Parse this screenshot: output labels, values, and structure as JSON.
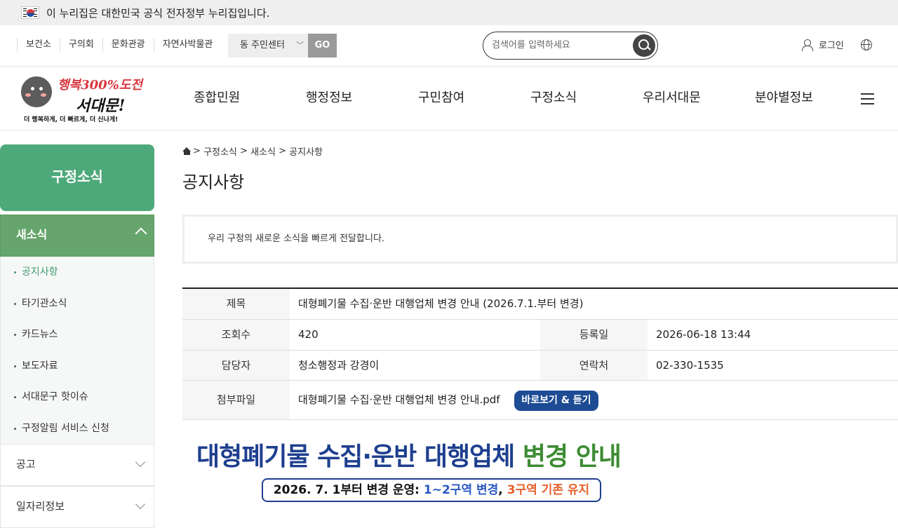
{
  "govbar": {
    "text": "이 누리집은 대한민국 공식 전자정부 누리집입니다."
  },
  "utility": {
    "links": [
      "보건소",
      "구의회",
      "문화관광",
      "자연사박물관"
    ],
    "dong_select": "동 주민센터",
    "go_label": "GO",
    "search_placeholder": "검색어를 입력하세요",
    "login_label": "로그인"
  },
  "logo": {
    "line1": "행복300%도전",
    "line2": "서대문!",
    "tagline": "더 행복하게, 더 빠르게, 더 신나게!"
  },
  "gnb": {
    "items": [
      "종합민원",
      "행정정보",
      "구민참여",
      "구정소식",
      "우리서대문",
      "분야별정보"
    ]
  },
  "sidebar": {
    "title": "구정소식",
    "section_open": "새소식",
    "items": [
      "공지사항",
      "타기관소식",
      "카드뉴스",
      "보도자료",
      "서대문구 핫이슈",
      "구정알림 서비스 신청"
    ],
    "section_2": "공고",
    "section_3": "일자리정보"
  },
  "breadcrumb": {
    "items": [
      "구정소식",
      "새소식",
      "공지사항"
    ],
    "sep": ">"
  },
  "page_title": "공지사항",
  "notice_text": "우리 구청의 새로운 소식을 빠르게 전달합니다.",
  "detail": {
    "title_label": "제목",
    "title_value": "대형폐기물 수집·운반 대행업체 변경 안내 (2026.7.1.부터 변경)",
    "views_label": "조회수",
    "views_value": "420",
    "date_label": "등록일",
    "date_value": "2026-06-18 13:44",
    "manager_label": "담당자",
    "manager_value": "청소행정과 강경이",
    "contact_label": "연락처",
    "contact_value": "02-330-1535",
    "attach_label": "첨부파일",
    "attach_value": "대형폐기물 수집·운반 대행업체 변경 안내.pdf",
    "preview_label": "바로보기 & 듣기"
  },
  "banner": {
    "headline_a": "대형폐기물 수집·운반 대행업체 ",
    "headline_b": "변경 안내",
    "sub_a": "2026. 7. 1부터 변경 운영: ",
    "sub_b": "1~2구역 변경",
    "sub_c": ", ",
    "sub_d": "3구역 기존 유지"
  },
  "colors": {
    "accent_green": "#4ea97a",
    "sub_green": "#66a56b",
    "button_blue": "#1d4b94"
  }
}
